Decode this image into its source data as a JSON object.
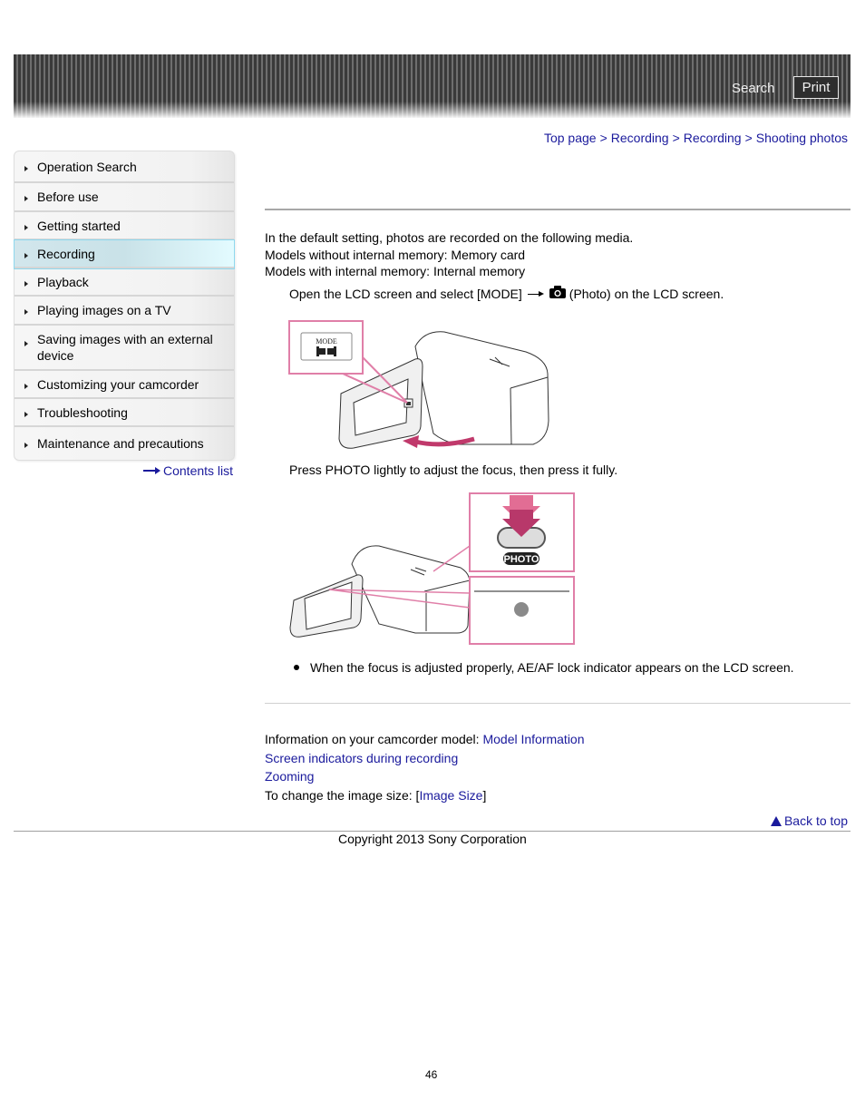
{
  "header": {
    "search_label": "Search",
    "print_label": "Print"
  },
  "breadcrumb": {
    "items": [
      "Top page",
      "Recording",
      "Recording",
      "Shooting photos"
    ],
    "separator": ">"
  },
  "sidebar": {
    "items": [
      {
        "label": "Operation Search",
        "active": false
      },
      {
        "label": "Before use",
        "active": false
      },
      {
        "label": "Getting started",
        "active": false
      },
      {
        "label": "Recording",
        "active": true
      },
      {
        "label": "Playback",
        "active": false
      },
      {
        "label": "Playing images on a TV",
        "active": false
      },
      {
        "label": "Saving images with an external device",
        "active": false
      },
      {
        "label": "Customizing your camcorder",
        "active": false
      },
      {
        "label": "Troubleshooting",
        "active": false
      },
      {
        "label": "Maintenance and precautions",
        "active": false
      }
    ],
    "contents_list_label": "Contents list"
  },
  "main": {
    "intro": [
      "In the default setting, photos are recorded on the following media.",
      "Models without internal memory: Memory card",
      "Models with internal memory: Internal memory"
    ],
    "step1": {
      "before": "Open the LCD screen and select [MODE]",
      "after": "(Photo) on the LCD screen."
    },
    "figure1": {
      "mode_label": "MODE"
    },
    "step2": "Press PHOTO lightly to adjust the focus, then press it fully.",
    "figure2": {
      "button_label": "PHOTO"
    },
    "note": "When the focus is adjusted properly, AE/AF lock indicator appears on the LCD screen.",
    "related": {
      "model_info_prefix": "Information on your camcorder model: ",
      "model_info_link": "Model Information",
      "screen_indicators_link": "Screen indicators during recording",
      "zooming_link": "Zooming",
      "image_size_prefix": "To change the image size: [",
      "image_size_link": "Image Size",
      "image_size_suffix": "]"
    }
  },
  "footer": {
    "back_to_top": "Back to top",
    "copyright": "Copyright 2013 Sony Corporation",
    "page_number": "46"
  },
  "colors": {
    "link": "#1a1a9c",
    "callout_border": "#e07fa8",
    "arrow_magenta": "#c0396b",
    "active_nav": "#c9e2e8"
  }
}
